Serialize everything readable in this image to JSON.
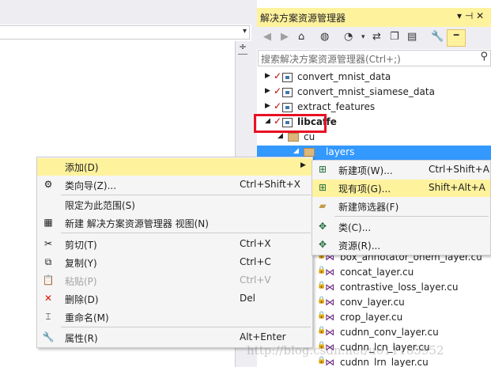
{
  "solution_explorer": {
    "title": "解决方案资源管理器",
    "title_buttons": "▾ ⊣ ✕",
    "search_placeholder": "搜索解决方案资源管理器(Ctrl+;)",
    "tree": [
      {
        "label": "convert_mnist_data",
        "type": "project"
      },
      {
        "label": "convert_mnist_siamese_data",
        "type": "project"
      },
      {
        "label": "extract_features",
        "type": "project"
      },
      {
        "label": "libcaffe",
        "type": "project",
        "expanded": true,
        "highlighted": true
      },
      {
        "label": "cu",
        "type": "folder"
      },
      {
        "label": "layers",
        "type": "folder",
        "selected": true
      }
    ],
    "files": [
      "box_annotator_ohem_layer.cu",
      "concat_layer.cu",
      "contrastive_loss_layer.cu",
      "conv_layer.cu",
      "crop_layer.cu",
      "cudnn_conv_layer.cu",
      "cudnn_lcn_layer.cu",
      "cudnn_lrn_layer.cu"
    ]
  },
  "context_menu": [
    {
      "label": "添加(D)",
      "shortcut": "",
      "icon": "none",
      "submenu": true,
      "highlighted": true
    },
    {
      "label": "类向导(Z)...",
      "shortcut": "Ctrl+Shift+X",
      "icon": "class-wizard-icon"
    },
    {
      "separator": true
    },
    {
      "label": "限定为此范围(S)",
      "shortcut": "",
      "icon": "none"
    },
    {
      "label": "新建 解决方案资源管理器 视图(N)",
      "shortcut": "",
      "icon": "new-view-icon"
    },
    {
      "separator": true
    },
    {
      "label": "剪切(T)",
      "shortcut": "Ctrl+X",
      "icon": "scissors-icon"
    },
    {
      "label": "复制(Y)",
      "shortcut": "Ctrl+C",
      "icon": "copy-icon"
    },
    {
      "label": "粘贴(P)",
      "shortcut": "Ctrl+V",
      "icon": "paste-icon",
      "disabled": true
    },
    {
      "label": "删除(D)",
      "shortcut": "Del",
      "icon": "delete-icon"
    },
    {
      "label": "重命名(M)",
      "shortcut": "",
      "icon": "rename-icon"
    },
    {
      "separator": true
    },
    {
      "label": "属性(R)",
      "shortcut": "Alt+Enter",
      "icon": "wrench-icon"
    }
  ],
  "submenu": [
    {
      "label": "新建项(W)...",
      "shortcut": "Ctrl+Shift+A",
      "icon": "new-item-icon"
    },
    {
      "label": "现有项(G)...",
      "shortcut": "Shift+Alt+A",
      "icon": "existing-item-icon",
      "highlighted": true
    },
    {
      "label": "新建筛选器(F)",
      "shortcut": "",
      "icon": "new-filter-icon"
    },
    {
      "separator": true
    },
    {
      "label": "类(C)...",
      "shortcut": "",
      "icon": "class-icon"
    },
    {
      "label": "资源(R)...",
      "shortcut": "",
      "icon": "resource-icon"
    }
  ],
  "watermark": "http://blog.csdn.net/u011185952",
  "colors": {
    "highlight": "#fff29d",
    "selection": "#3399ff",
    "red_box": "#e81123",
    "vs_purple": "#68217a"
  }
}
